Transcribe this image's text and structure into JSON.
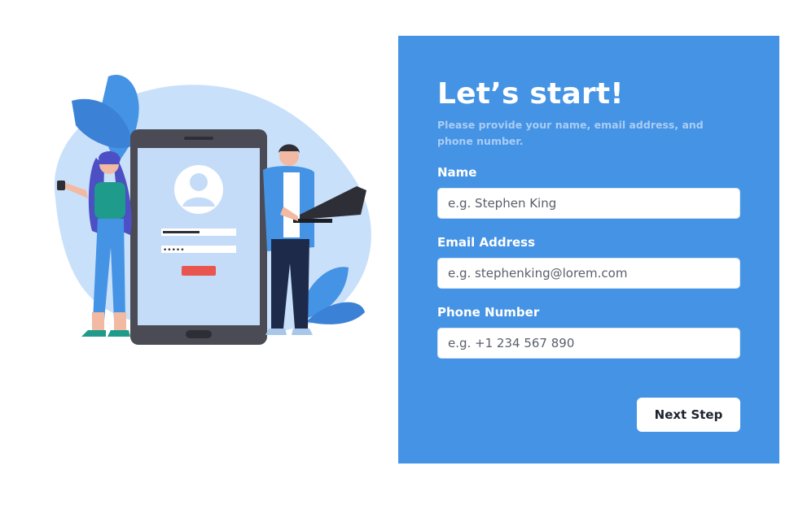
{
  "form": {
    "title": "Let’s start!",
    "subtitle": "Please provide your name, email address, and phone number.",
    "fields": [
      {
        "label": "Name",
        "placeholder": "e.g. Stephen King"
      },
      {
        "label": "Email Address",
        "placeholder": "e.g. stephenking@lorem.com"
      },
      {
        "label": "Phone Number",
        "placeholder": "e.g. +1 234 567 890"
      }
    ],
    "next_button_label": "Next Step"
  },
  "illustration": {
    "name": "signup-illustration",
    "password_mask": "•••••"
  },
  "colors": {
    "panel_background": "#4593e4",
    "subtitle": "#a9cdf5",
    "illustration_blob": "#c9e0fa",
    "phone_body": "#4a4b55",
    "accent_button": "#e8564f"
  }
}
